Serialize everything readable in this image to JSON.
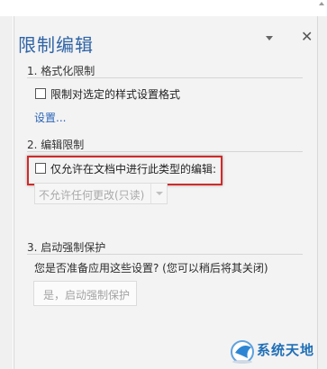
{
  "pane": {
    "title": "限制编辑",
    "close_symbol": "✕"
  },
  "formatting": {
    "heading": "1. 格式化限制",
    "checkbox_label": "限制对选定的样式设置格式",
    "settings_link": "设置..."
  },
  "editing": {
    "heading": "2. 编辑限制",
    "checkbox_label": "仅允许在文档中进行此类型的编辑:",
    "dropdown_value": "不允许任何更改(只读)"
  },
  "enforcement": {
    "heading": "3. 启动强制保护",
    "question": "您是否准备应用这些设置? (您可以稍后将其关闭)",
    "button_label": "是，启动强制保护"
  },
  "watermark": {
    "text": "系统天地"
  },
  "colors": {
    "title": "#2f64a6",
    "link": "#2c66b8",
    "highlight": "#d02a2a"
  }
}
